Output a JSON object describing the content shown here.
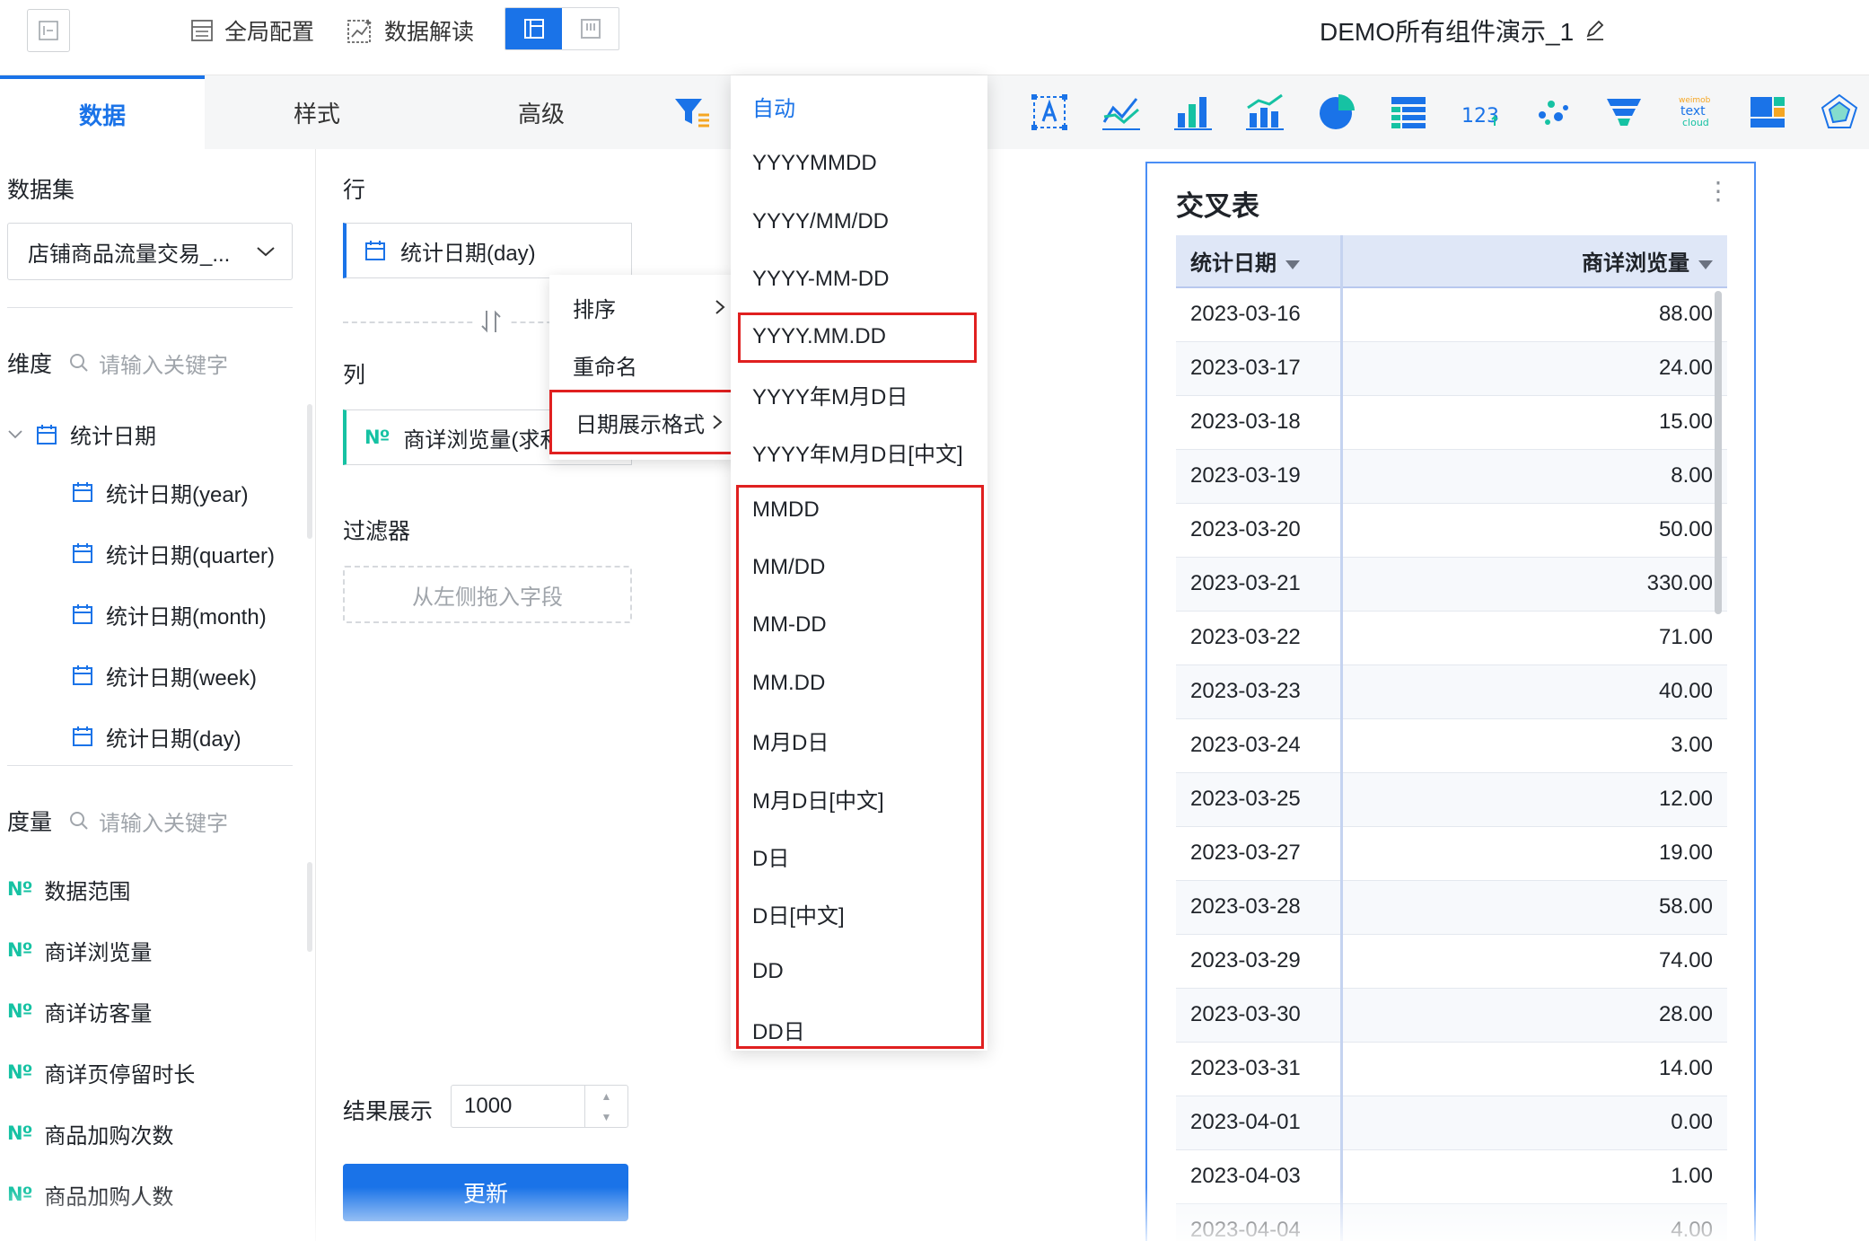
{
  "topbar": {
    "global_config": "全局配置",
    "data_interpret": "数据解读",
    "dashboard_title": "DEMO所有组件演示_1"
  },
  "tabs": [
    {
      "label": "数据",
      "active": true
    },
    {
      "label": "样式",
      "active": false
    },
    {
      "label": "高级",
      "active": false
    }
  ],
  "left": {
    "dataset_title": "数据集",
    "dataset_value": "店铺商品流量交易_...",
    "dimension_title": "维度",
    "dimension_search_placeholder": "请输入关键字",
    "dimension_group": "统计日期",
    "dimension_items": [
      "统计日期(year)",
      "统计日期(quarter)",
      "统计日期(month)",
      "统计日期(week)",
      "统计日期(day)"
    ],
    "measure_title": "度量",
    "measure_search_placeholder": "请输入关键字",
    "measure_items": [
      "数据范围",
      "商详浏览量",
      "商详访客量",
      "商详页停留时长",
      "商品加购次数",
      "商品加购人数"
    ]
  },
  "middle": {
    "row_title": "行",
    "row_field": "统计日期(day)",
    "column_title": "列",
    "column_field": "商详浏览量(求和)",
    "filter_title": "过滤器",
    "filter_placeholder": "从左侧拖入字段",
    "result_label": "结果展示",
    "result_value": "1000",
    "update_label": "更新"
  },
  "context_menu": {
    "sort": "排序",
    "rename": "重命名",
    "date_format": "日期展示格式"
  },
  "format_menu": {
    "options": [
      "自动",
      "YYYYMMDD",
      "YYYY/MM/DD",
      "YYYY-MM-DD",
      "YYYY.MM.DD",
      "YYYY年M月D日",
      "YYYY年M月D日[中文]",
      "MMDD",
      "MM/DD",
      "MM-DD",
      "MM.DD",
      "M月D日",
      "M月D日[中文]",
      "D日",
      "D日[中文]",
      "DD",
      "DD日"
    ],
    "selected": "自动"
  },
  "chart_toolbar_icons": [
    "filter-icon",
    "text-chart-icon",
    "line-chart-icon",
    "bar-chart-icon",
    "combo-chart-icon",
    "pie-chart-icon",
    "table-chart-icon",
    "number-card-icon",
    "scatter-chart-icon",
    "funnel-chart-icon",
    "word-cloud-icon",
    "treemap-icon",
    "radar-chart-icon"
  ],
  "word_cloud_text": {
    "line1": "weimob",
    "line2": "text",
    "line3": "cloud"
  },
  "number_card_text": "123",
  "table_card": {
    "title": "交叉表",
    "headers": {
      "date": "统计日期",
      "value": "商详浏览量"
    },
    "rows": [
      {
        "date": "2023-03-16",
        "value": "88.00"
      },
      {
        "date": "2023-03-17",
        "value": "24.00"
      },
      {
        "date": "2023-03-18",
        "value": "15.00"
      },
      {
        "date": "2023-03-19",
        "value": "8.00"
      },
      {
        "date": "2023-03-20",
        "value": "50.00"
      },
      {
        "date": "2023-03-21",
        "value": "330.00"
      },
      {
        "date": "2023-03-22",
        "value": "71.00"
      },
      {
        "date": "2023-03-23",
        "value": "40.00"
      },
      {
        "date": "2023-03-24",
        "value": "3.00"
      },
      {
        "date": "2023-03-25",
        "value": "12.00"
      },
      {
        "date": "2023-03-27",
        "value": "19.00"
      },
      {
        "date": "2023-03-28",
        "value": "58.00"
      },
      {
        "date": "2023-03-29",
        "value": "74.00"
      },
      {
        "date": "2023-03-30",
        "value": "28.00"
      },
      {
        "date": "2023-03-31",
        "value": "14.00"
      },
      {
        "date": "2023-04-01",
        "value": "0.00"
      },
      {
        "date": "2023-04-03",
        "value": "1.00"
      },
      {
        "date": "2023-04-04",
        "value": "4.00"
      }
    ]
  },
  "colors": {
    "accent": "#1a73e8",
    "measure_icon": "#16c2a3",
    "highlight": "#e02020"
  }
}
